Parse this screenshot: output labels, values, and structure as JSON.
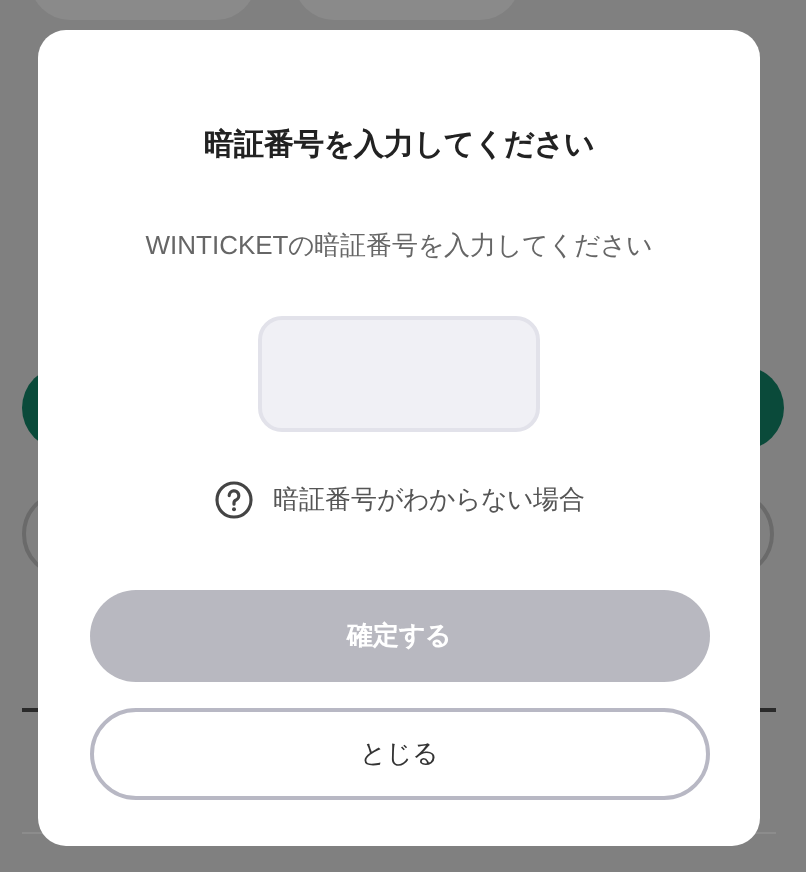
{
  "dialog": {
    "title": "暗証番号を入力してください",
    "message": "WINTICKETの暗証番号を入力してください",
    "help_link": "暗証番号がわからない場合",
    "confirm_button": {
      "label": "確定する",
      "disabled": true
    },
    "close_button": {
      "label": "とじる"
    }
  }
}
